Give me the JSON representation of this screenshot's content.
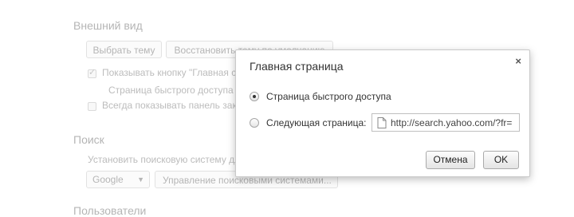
{
  "background": {
    "appearance": {
      "title": "Внешний вид",
      "choose_theme_button": "Выбрать тему",
      "reset_theme_button": "Восстановить тему по умолчанию",
      "show_home_button_label": "Показывать кнопку \"Главная страница\"",
      "home_subtext": "Страница быстрого доступа",
      "show_bookmarks_bar_label": "Всегда показывать панель закладок"
    },
    "search": {
      "title": "Поиск",
      "description": "Установить поисковую систему для омнибокса",
      "engine_select_value": "Google",
      "manage_engines_button": "Управление поисковыми системами..."
    },
    "users": {
      "title": "Пользователи"
    }
  },
  "dialog": {
    "title": "Главная страница",
    "close_glyph": "×",
    "options": {
      "ntp_label": "Страница быстрого доступа",
      "url_label": "Следующая страница:"
    },
    "url_value": "http://search.yahoo.com/?fr=",
    "cancel_button": "Отмена",
    "ok_button": "OK"
  },
  "icons": {
    "page_icon": "page-icon",
    "close_icon": "close-icon",
    "dropdown_arrow": "chevron-down-icon"
  }
}
